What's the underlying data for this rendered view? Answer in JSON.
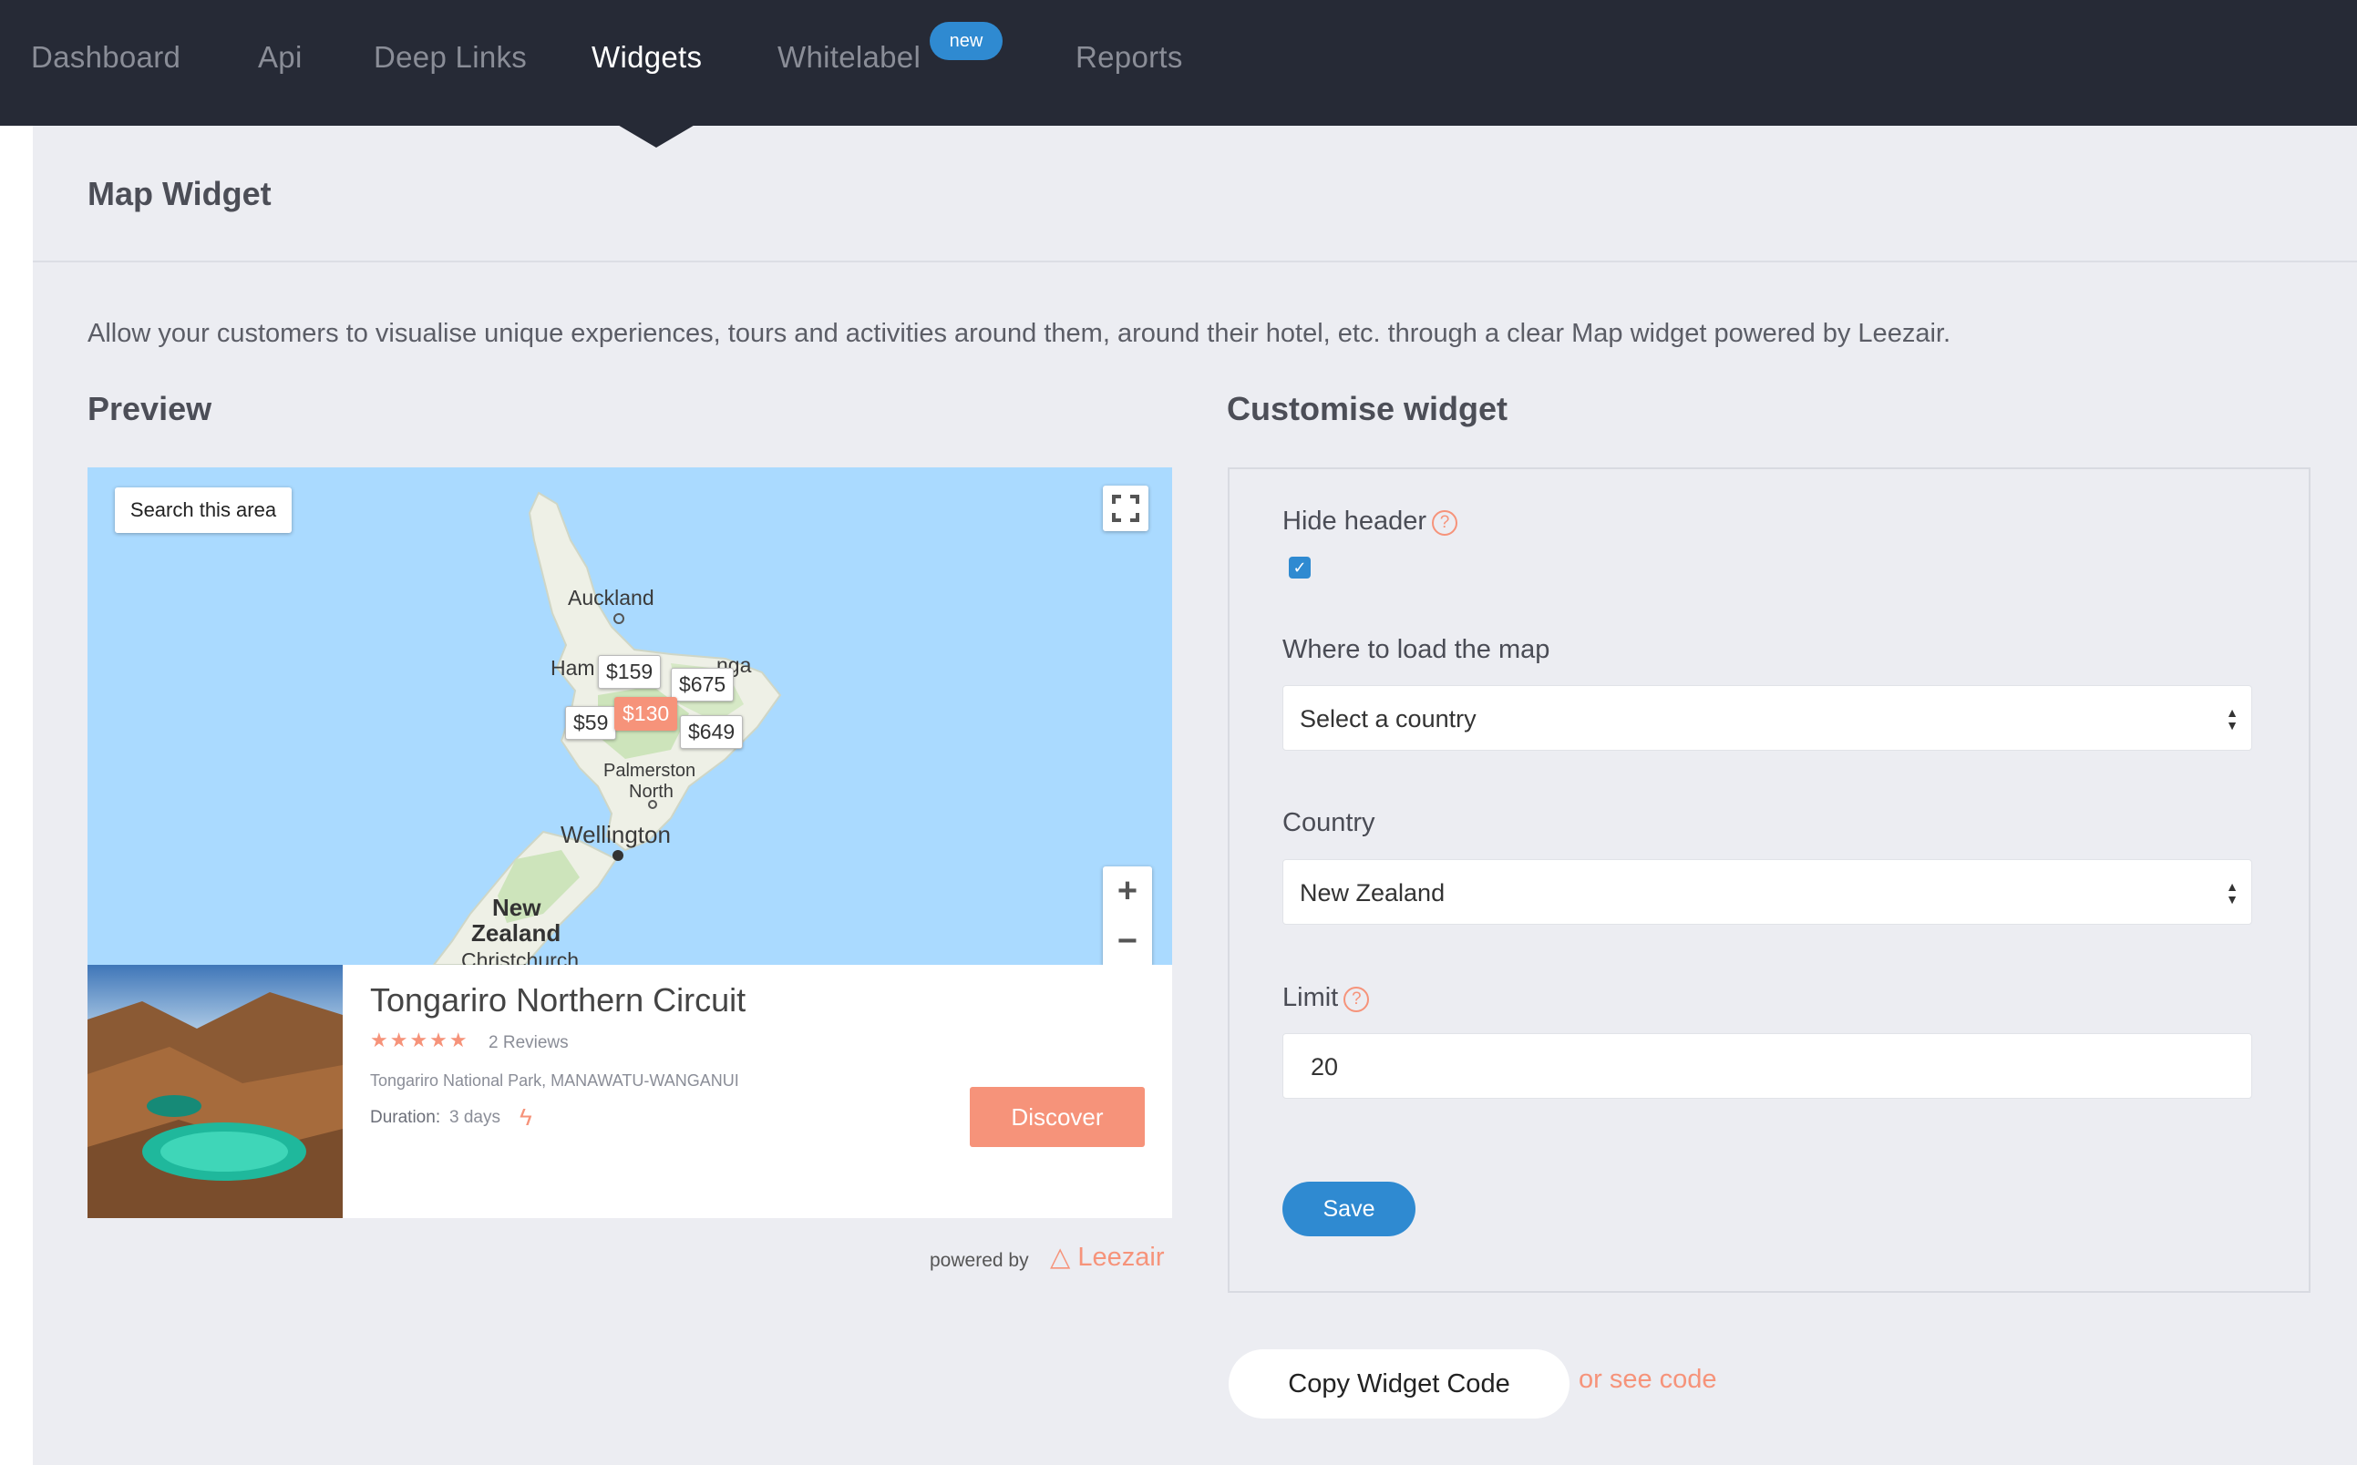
{
  "nav": {
    "items": [
      "Dashboard",
      "Api",
      "Deep Links",
      "Widgets",
      "Whitelabel",
      "Reports"
    ],
    "active": "Widgets",
    "badge": "new"
  },
  "page": {
    "title": "Map Widget",
    "intro": "Allow your customers to visualise unique experiences, tours and activities around them, around their hotel, etc. through a clear Map widget powered by Leezair."
  },
  "preview": {
    "heading": "Preview",
    "search_area": "Search this area",
    "zoom_in": "+",
    "zoom_out": "−",
    "cities": [
      "Auckland",
      "Ham",
      "nga",
      "Palmerston",
      "North",
      "Wellington",
      "New",
      "Zealand",
      "Christchurch"
    ],
    "prices": [
      "$159",
      "$675",
      "$59",
      "$130",
      "$649"
    ],
    "card": {
      "title": "Tongariro Northern Circuit",
      "stars": "★★★★★",
      "reviews": "2 Reviews",
      "location": "Tongariro National Park, MANAWATU-WANGANUI",
      "duration_label": "Duration:",
      "duration_value": "3 days",
      "cta": "Discover"
    },
    "powered_by": "powered by",
    "brand": "Leezair"
  },
  "customise": {
    "heading": "Customise widget",
    "hide_header": {
      "label": "Hide header",
      "checked": true
    },
    "where_to_load": {
      "label": "Where to load the map",
      "value": "Select a country"
    },
    "country": {
      "label": "Country",
      "value": "New Zealand"
    },
    "limit": {
      "label": "Limit",
      "value": "20"
    },
    "save": "Save"
  },
  "footer": {
    "copy_code": "Copy Widget Code",
    "see_code": "or see code"
  },
  "colors": {
    "nav_bg": "#262a36",
    "accent": "#f6937a",
    "primary": "#2f8ad1",
    "page_bg": "#ecedf2",
    "map_water": "#aadaff"
  }
}
